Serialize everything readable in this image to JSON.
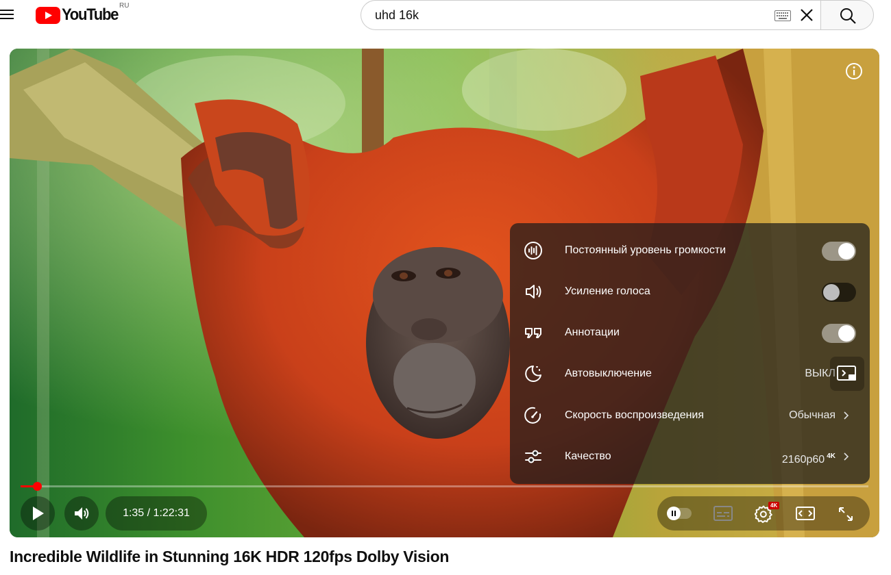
{
  "header": {
    "logo_text": "YouTube",
    "region": "RU",
    "search_value": "uhd 16k",
    "search_placeholder": "Введите запрос"
  },
  "player": {
    "current_time": "1:35",
    "duration": "1:22:31",
    "time_display": "1:35 / 1:22:31",
    "progress_fraction": 0.019,
    "quality_badge": "4K",
    "progress_color": "#ff0000"
  },
  "settings": {
    "items": [
      {
        "icon": "stable-volume-icon",
        "label": "Постоянный уровень громкости",
        "type": "toggle",
        "on": true
      },
      {
        "icon": "voice-boost-icon",
        "label": "Усиление голоса",
        "type": "toggle",
        "on": false
      },
      {
        "icon": "annotations-icon",
        "label": "Аннотации",
        "type": "toggle",
        "on": true
      },
      {
        "icon": "sleep-timer-icon",
        "label": "Автовыключение",
        "type": "value",
        "value": "ВЫКЛ"
      },
      {
        "icon": "playback-speed-icon",
        "label": "Скорость воспроизведения",
        "type": "value",
        "value": "Обычная"
      },
      {
        "icon": "quality-icon",
        "label": "Качество",
        "type": "value",
        "value": "2160p60",
        "badge": "4K"
      }
    ]
  },
  "video": {
    "title": "Incredible Wildlife in Stunning 16K HDR 120fps Dolby Vision"
  }
}
